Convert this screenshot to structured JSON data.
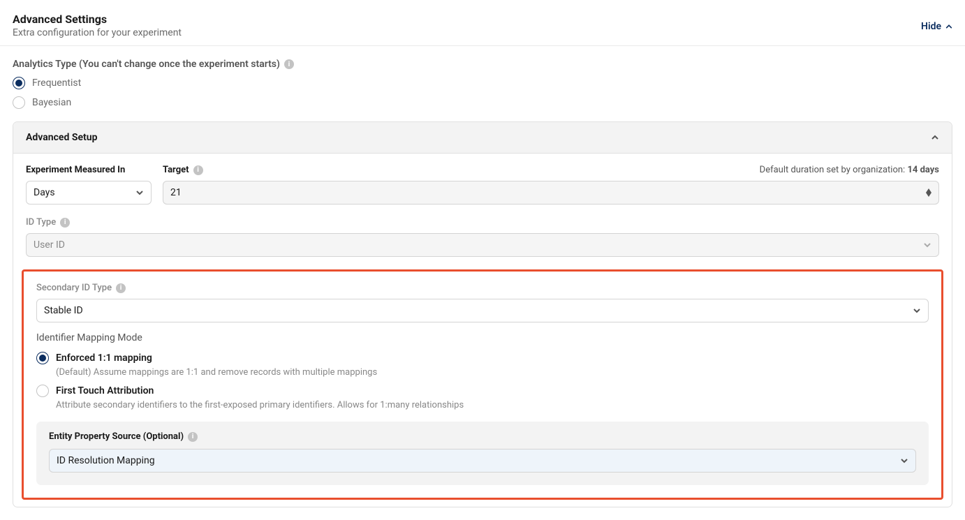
{
  "header": {
    "title": "Advanced Settings",
    "subtitle": "Extra configuration for your experiment",
    "hide_label": "Hide"
  },
  "analytics": {
    "label": "Analytics Type (You can't change once the experiment starts)",
    "options": {
      "frequentist": "Frequentist",
      "bayesian": "Bayesian"
    },
    "selected": "frequentist"
  },
  "advanced_setup": {
    "title": "Advanced Setup",
    "measured_in": {
      "label": "Experiment Measured In",
      "value": "Days"
    },
    "target": {
      "label": "Target",
      "value": "21",
      "default_prefix": "Default duration set by organization: ",
      "default_value": "14 days"
    },
    "id_type": {
      "label": "ID Type",
      "value": "User ID"
    }
  },
  "secondary": {
    "label": "Secondary ID Type",
    "value": "Stable ID",
    "mapping_mode_label": "Identifier Mapping Mode",
    "options": {
      "enforced": {
        "label": "Enforced 1:1 mapping",
        "desc": "(Default) Assume mappings are 1:1 and remove records with multiple mappings"
      },
      "first_touch": {
        "label": "First Touch Attribution",
        "desc": "Attribute secondary identifiers to the first-exposed primary identifiers. Allows for 1:many relationships"
      }
    },
    "entity": {
      "label": "Entity Property Source (Optional)",
      "value": "ID Resolution Mapping"
    }
  }
}
